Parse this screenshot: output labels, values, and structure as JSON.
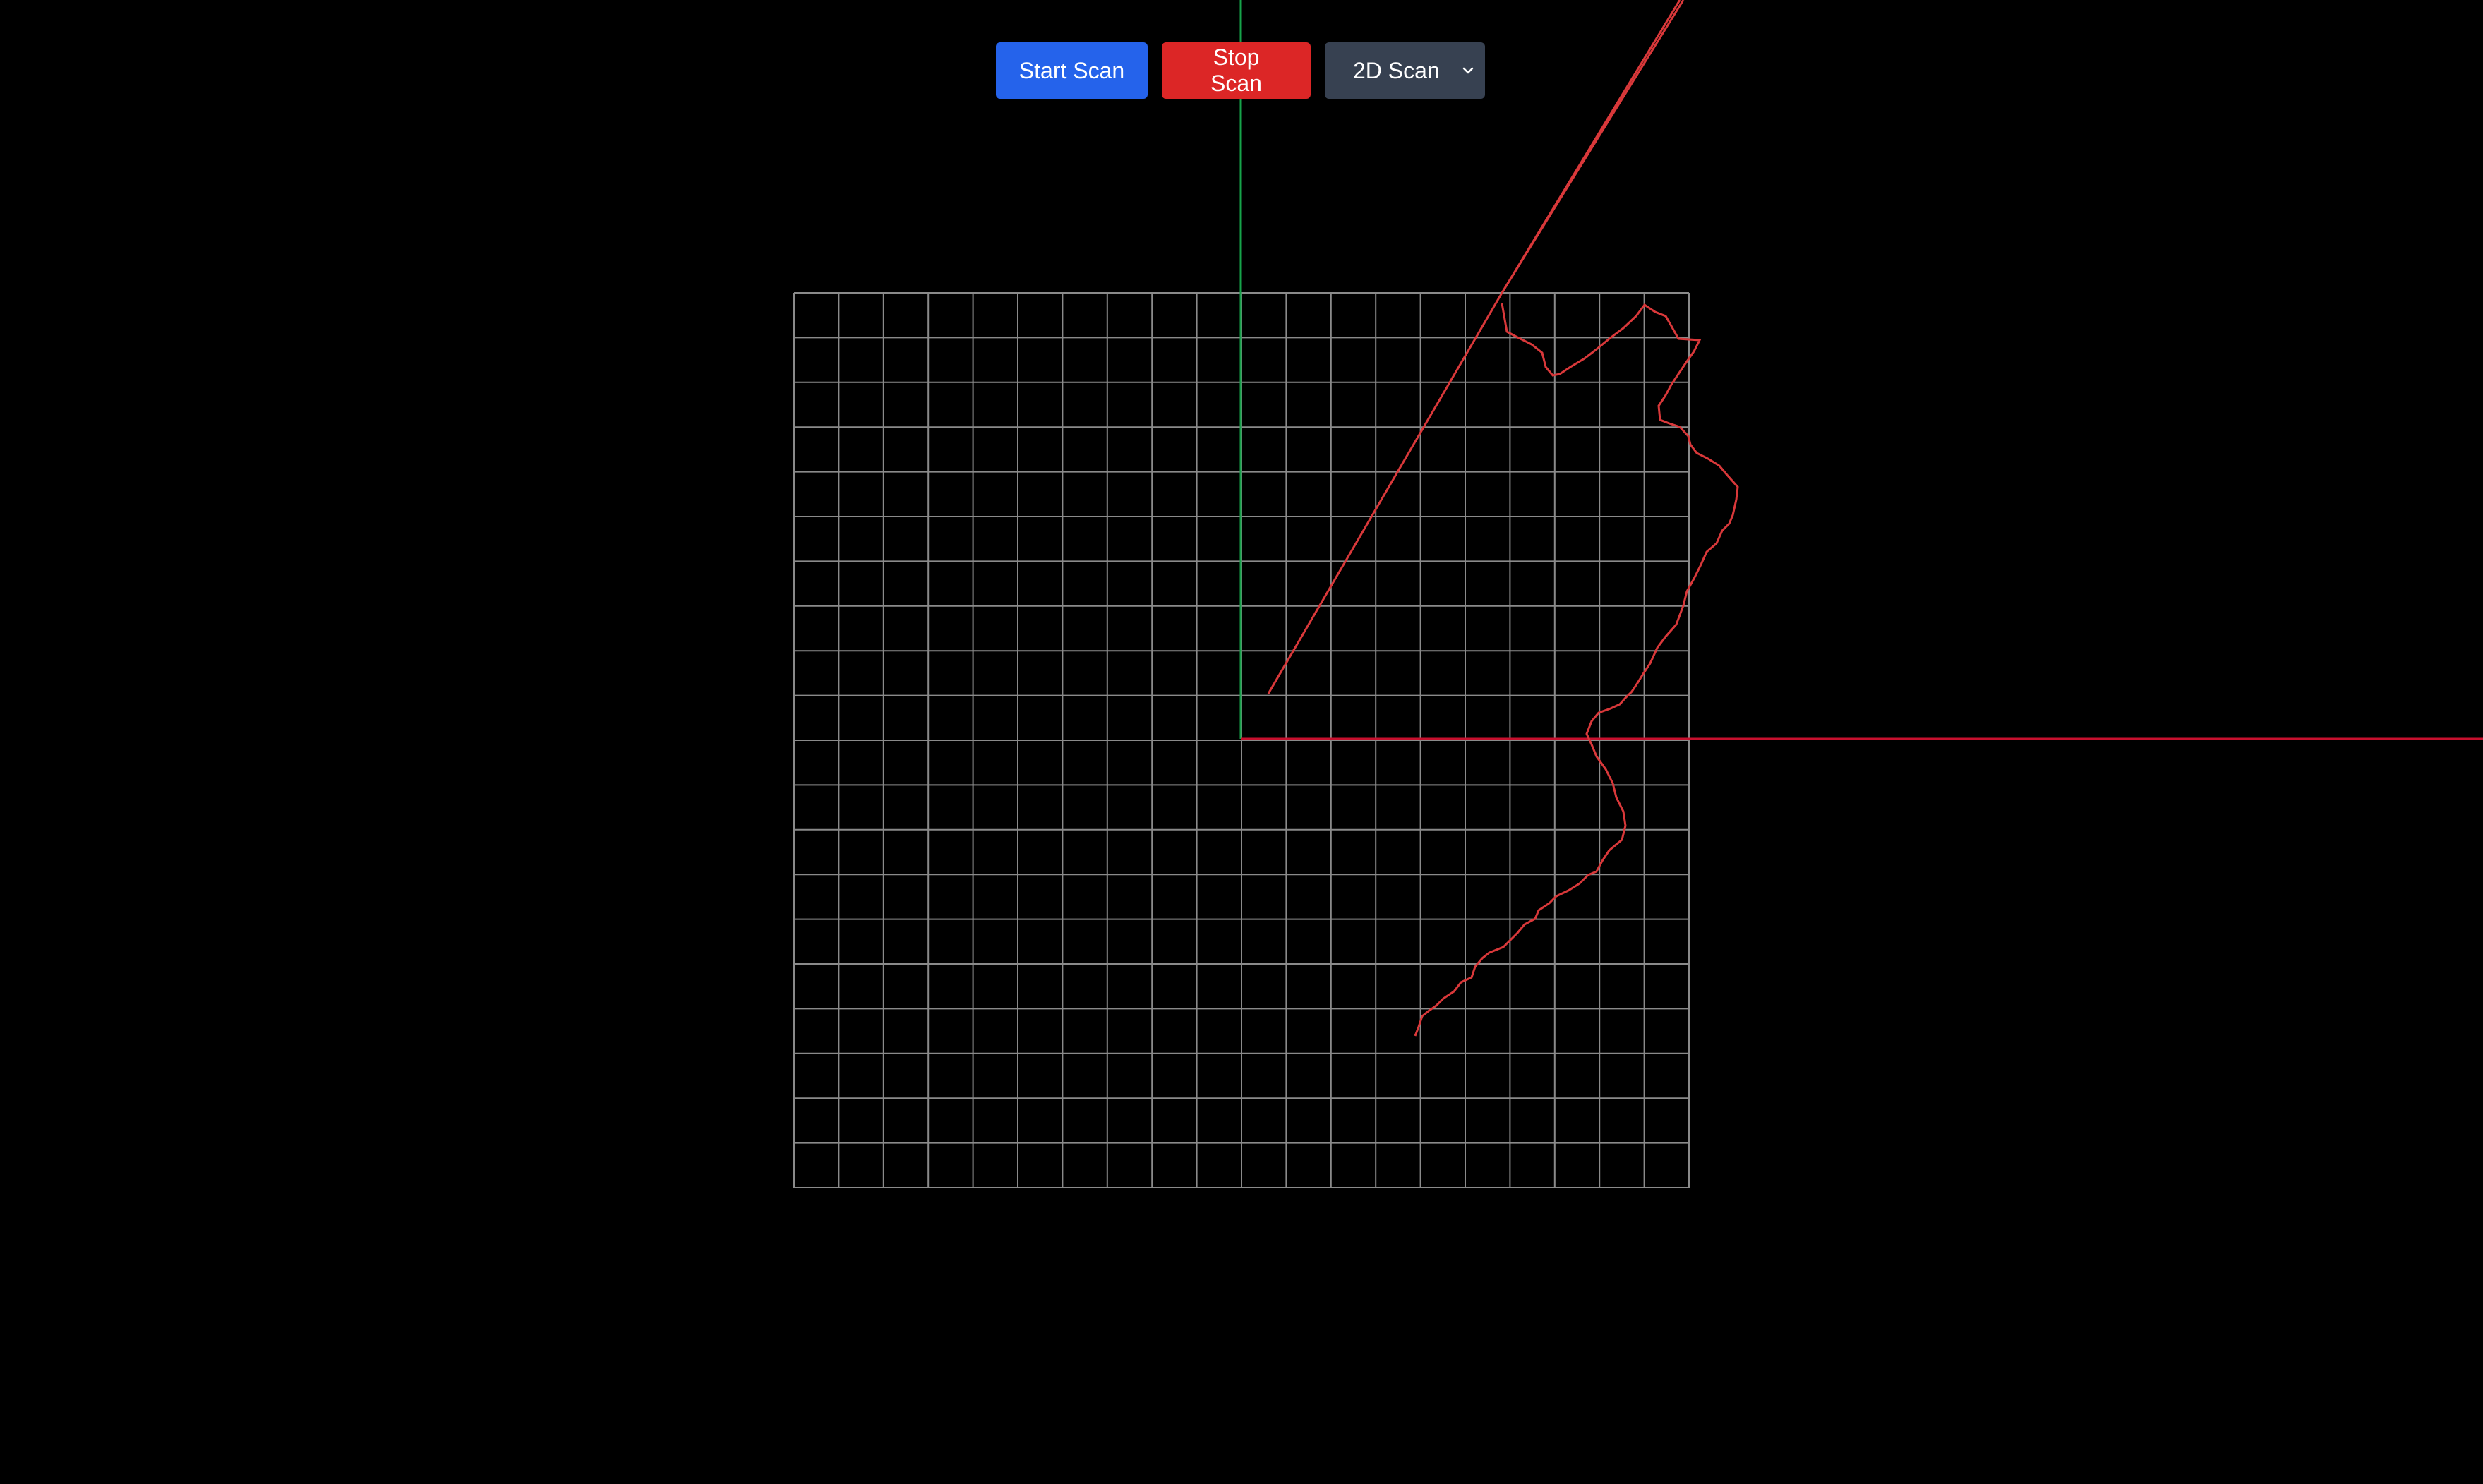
{
  "toolbar": {
    "start_label": "Start Scan",
    "stop_label": "Stop Scan",
    "mode_selected": "2D Scan",
    "mode_icon": "chevron-down-icon"
  },
  "colors": {
    "background": "#000000",
    "start_button": "#2563eb",
    "stop_button": "#dc2626",
    "select_button": "#374151",
    "grid": "#8a8a8a",
    "scan_path": "#d9383a",
    "x_axis": "#c8102e",
    "y_axis": "#16a34a"
  },
  "scene": {
    "view": "2D scan viewport",
    "grid_divisions": 20
  }
}
